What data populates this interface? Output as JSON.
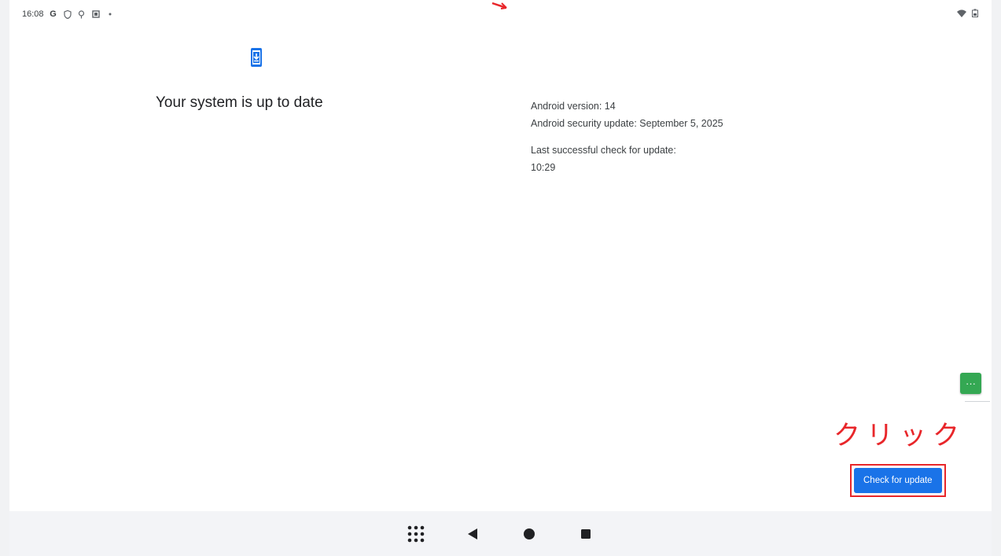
{
  "status_bar": {
    "time": "16:08",
    "left_icons": [
      "google-icon",
      "shield-icon",
      "location-icon",
      "notification-icon",
      "dot-icon"
    ],
    "right_icons": [
      "wifi-icon",
      "battery-icon"
    ]
  },
  "main": {
    "title": "Your system is up to date",
    "android_version": "Android version: 14",
    "security_update": "Android security update: September 5, 2025",
    "last_check_label": "Last successful check for update:",
    "last_check_time": "10:29"
  },
  "annotation": {
    "click_label": "クリック",
    "color": "#e8262a"
  },
  "actions": {
    "check_button": "Check for update",
    "fab_label": "···"
  },
  "colors": {
    "accent": "#1a73e8",
    "fab": "#34a853"
  },
  "nav": [
    "apps-grid-icon",
    "back-icon",
    "home-icon",
    "recents-icon"
  ]
}
